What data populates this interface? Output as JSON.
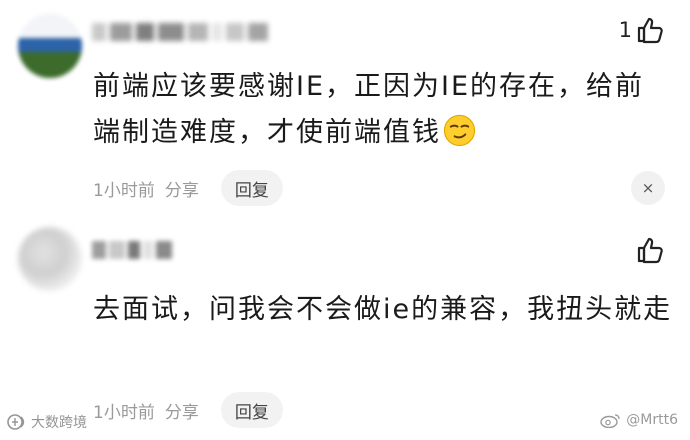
{
  "comments": [
    {
      "username": "·· ·· ·",
      "like_count": "1",
      "text": "前端应该要感谢IE，正因为IE的存在，给前端制造难度，才使前端值钱",
      "emoji": "smirk-emoji",
      "time": "1小时前",
      "share_label": "分享",
      "reply_label": "回复",
      "close_label": "×"
    },
    {
      "username": "·· ·",
      "like_count": "",
      "text": "去面试，问我会不会做ie的兼容，我扭头就走",
      "time": "1小时前",
      "share_label": "分享",
      "reply_label": "回复"
    }
  ],
  "watermark_left": "大数跨境",
  "watermark_right": "@Mrtt6",
  "colors": {
    "meta_gray": "#9a9a9a",
    "pill_bg": "#f2f2f2",
    "text": "#1a1a1a"
  }
}
